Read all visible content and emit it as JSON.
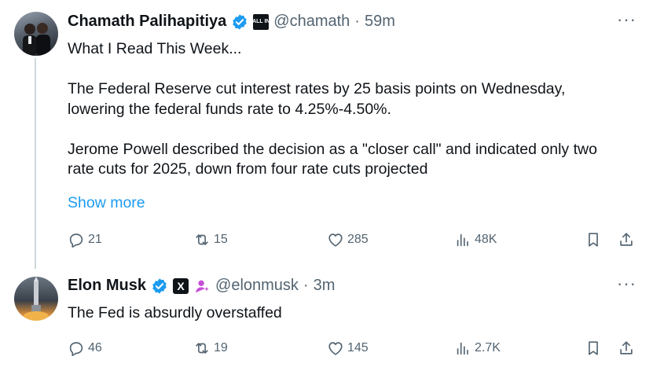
{
  "tweets": [
    {
      "name": "Chamath Palihapitiya",
      "affiliate_badge": "ALL IN",
      "handle": "@chamath",
      "separator": "·",
      "time": "59m",
      "more": "···",
      "paragraphs": [
        "What I Read This Week...",
        "The Federal Reserve cut interest rates by 25 basis points on Wednesday, lowering the federal funds rate to 4.25%-4.50%.",
        "Jerome Powell described the decision as a \"closer call\" and indicated only two rate cuts for 2025, down from four rate cuts projected"
      ],
      "show_more": "Show more",
      "replies": "21",
      "reposts": "15",
      "likes": "285",
      "views": "48K"
    },
    {
      "name": "Elon Musk",
      "affiliate_badge": "X",
      "handle": "@elonmusk",
      "separator": "·",
      "time": "3m",
      "more": "···",
      "text": "The Fed is absurdly overstaffed",
      "replies": "46",
      "reposts": "19",
      "likes": "145",
      "views": "2.7K"
    }
  ],
  "colors": {
    "accent": "#1d9bf0",
    "text": "#0f1419",
    "muted": "#536471",
    "thread_line": "#cfd9de"
  },
  "icons": [
    "verified-icon",
    "reply-icon",
    "retweet-icon",
    "like-icon",
    "views-icon",
    "bookmark-icon",
    "share-icon",
    "more-icon"
  ]
}
